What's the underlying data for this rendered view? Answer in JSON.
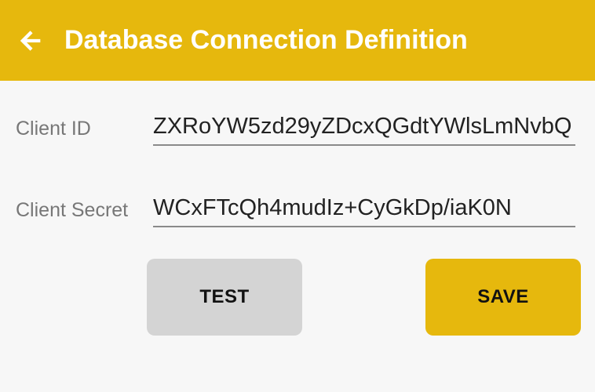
{
  "header": {
    "title": "Database Connection Definition",
    "back_icon": "arrow-left-icon",
    "background_color": "#e6b80d"
  },
  "form": {
    "client_id": {
      "label": "Client ID",
      "value": "ZXRoYW5zd29yZDcxQGdtYWlsLmNvbQ"
    },
    "client_secret": {
      "label": "Client Secret",
      "value": "WCxFTcQh4mudIz+CyGkDp/iaK0N"
    }
  },
  "buttons": {
    "test_label": "TEST",
    "save_label": "SAVE"
  }
}
